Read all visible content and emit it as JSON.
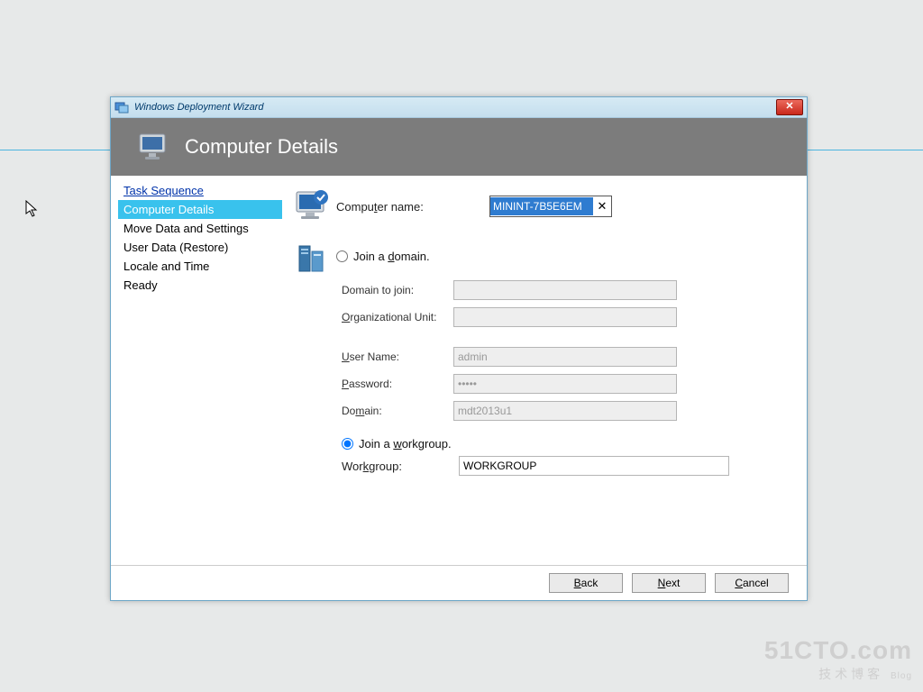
{
  "window": {
    "title": "Windows Deployment Wizard"
  },
  "banner": {
    "heading": "Computer Details"
  },
  "sidebar": {
    "items": [
      {
        "label": "Task Sequence",
        "class": "link"
      },
      {
        "label": "Computer Details",
        "class": "active"
      },
      {
        "label": "Move Data and Settings",
        "class": ""
      },
      {
        "label": "User Data (Restore)",
        "class": ""
      },
      {
        "label": "Locale and Time",
        "class": ""
      },
      {
        "label": "Ready",
        "class": ""
      }
    ]
  },
  "form": {
    "computerNameLabelPre": "Compu",
    "computerNameLabelU": "t",
    "computerNameLabelPost": "er name:",
    "computerNameValue": "MININT-7B5E6EM",
    "joinDomainPre": "Join a ",
    "joinDomainU": "d",
    "joinDomainPost": "omain.",
    "domainToJoinLabel": "Domain to join:",
    "ouLabelU": "O",
    "ouLabelPost": "rganizational Unit:",
    "userNameLabelU": "U",
    "userNameLabelPost": "ser Name:",
    "userNameValue": "admin",
    "passwordLabelU": "P",
    "passwordLabelPost": "assword:",
    "passwordValue": "•••••",
    "domainLabelU": "m",
    "domainLabelPre": "Do",
    "domainLabelPost": "ain:",
    "domainValue": "mdt2013u1",
    "joinWgPre": "Join a ",
    "joinWgU": "w",
    "joinWgPost": "orkgroup.",
    "workgroupLabelPre": "Wor",
    "workgroupLabelU": "k",
    "workgroupLabelPost": "group:",
    "workgroupValue": "WORKGROUP",
    "selected": "workgroup"
  },
  "footer": {
    "backU": "B",
    "backPost": "ack",
    "nextU": "N",
    "nextPost": "ext",
    "cancelU": "C",
    "cancelPost": "ancel"
  },
  "watermark": {
    "line1": "51CTO.com",
    "line2": "技术博客",
    "line2b": "Blog"
  }
}
